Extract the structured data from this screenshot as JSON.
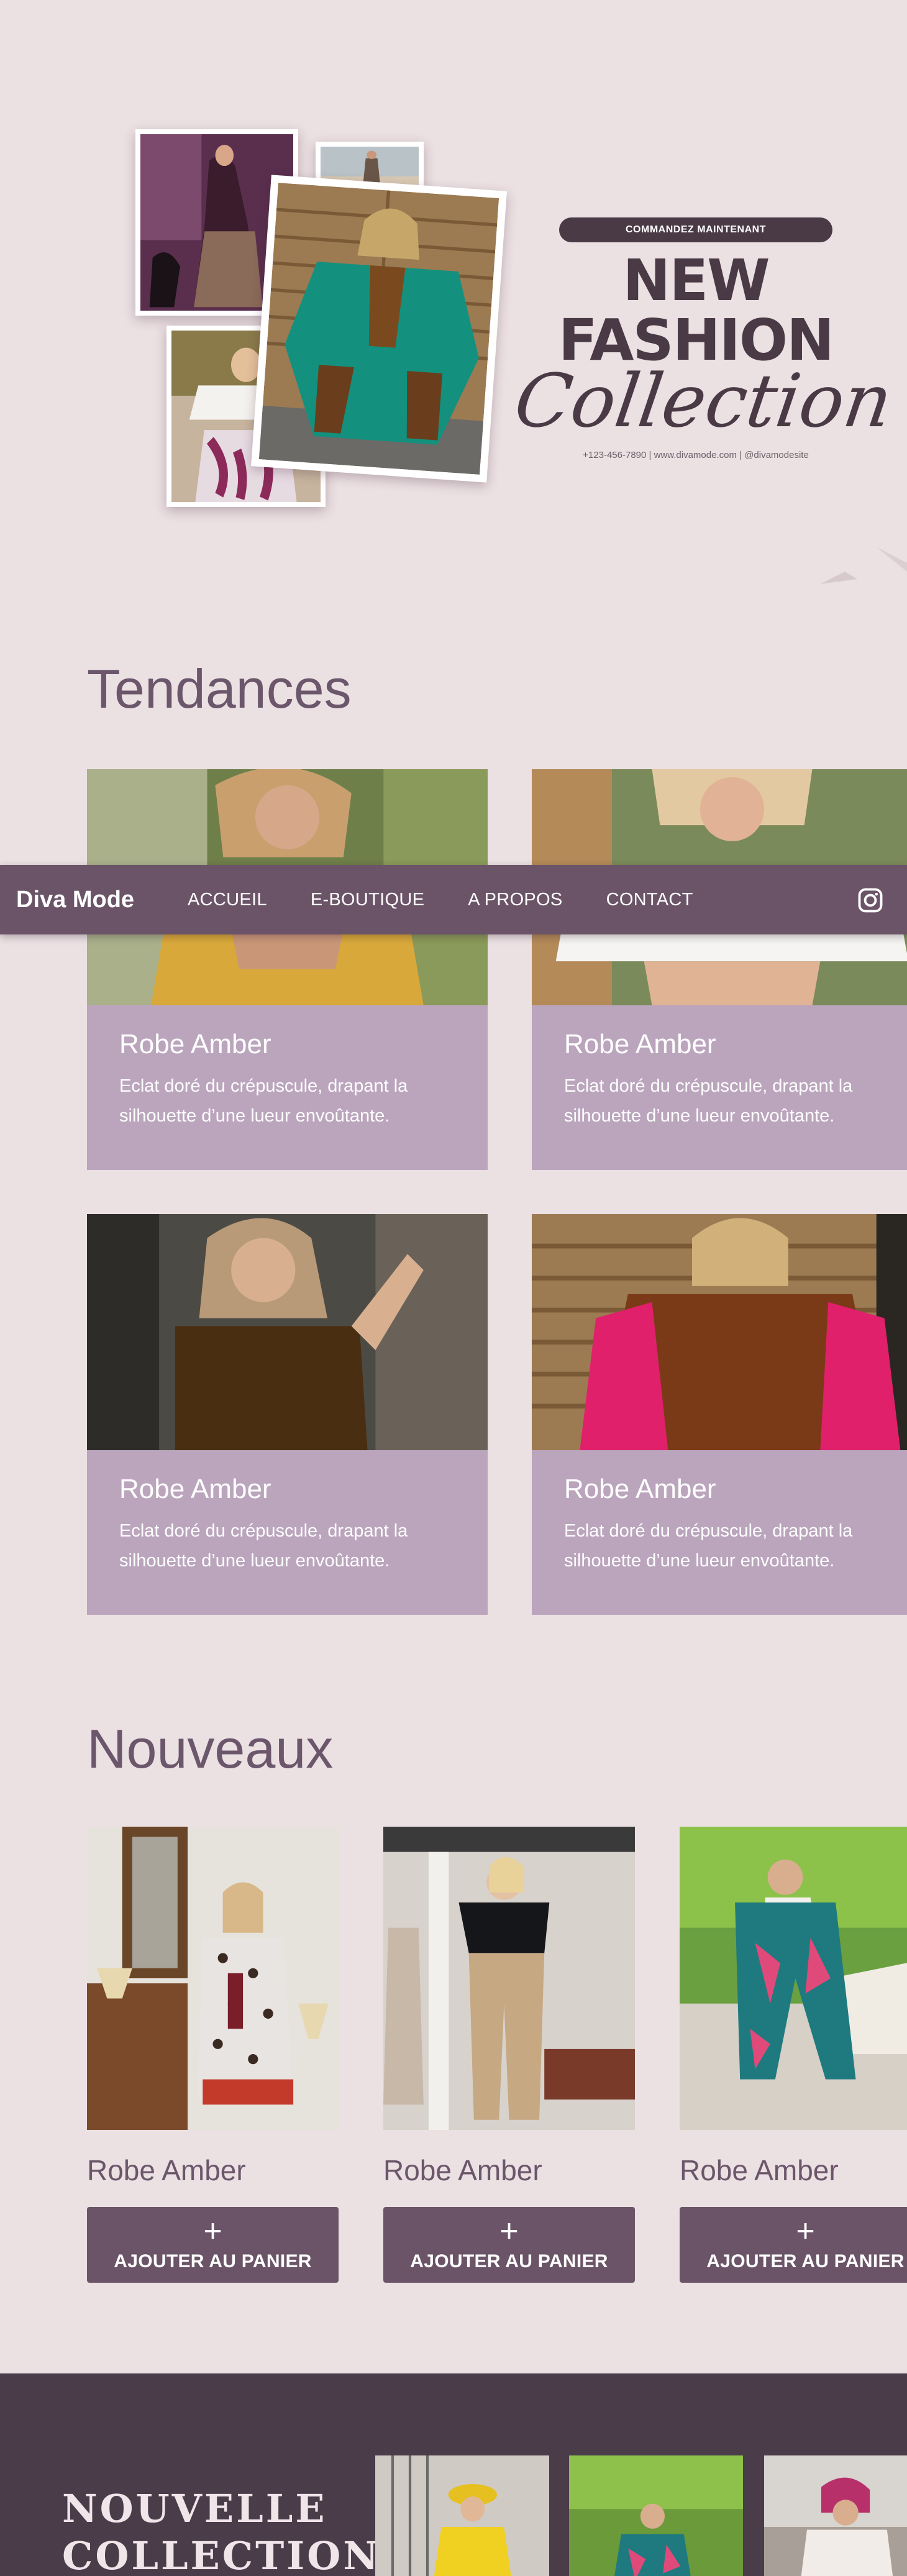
{
  "hero": {
    "cta": "COMMANDEZ MAINTENANT",
    "title_line1": "NEW FASHION",
    "title_line2": "Collection",
    "contact": "+123-456-7890 | www.divamode.com | @divamodesite",
    "photo_icons": [
      "photo-violet-dress",
      "photo-beach",
      "photo-teal-kaftan",
      "photo-white-top"
    ]
  },
  "nav": {
    "brand": "Diva Mode",
    "links": [
      "ACCUEIL",
      "E-BOUTIQUE",
      "A PROPOS",
      "CONTACT"
    ],
    "social_icon": "instagram-icon"
  },
  "tendances": {
    "title": "Tendances",
    "cards": [
      {
        "name": "Robe Amber",
        "desc_line1": "Eclat doré du crépuscule, drapant la",
        "desc_line2": "silhouette d’une lueur envoûtante."
      },
      {
        "name": "Robe Amber",
        "desc_line1": "Eclat doré du crépuscule, drapant la",
        "desc_line2": "silhouette d’une lueur envoûtante."
      },
      {
        "name": "Robe Amber",
        "desc_line1": "Eclat doré du crépuscule, drapant la",
        "desc_line2": "silhouette d’une lueur envoûtante."
      },
      {
        "name": "Robe Amber",
        "desc_line1": "Eclat doré du crépuscule, drapant la",
        "desc_line2": "silhouette d’une lueur envoûtante."
      }
    ]
  },
  "nouveaux": {
    "title": "Nouveaux",
    "items": [
      {
        "name": "Robe Amber",
        "button_icon": "+",
        "button": "AJOUTER AU PANIER"
      },
      {
        "name": "Robe Amber",
        "button_icon": "+",
        "button": "AJOUTER AU PANIER"
      },
      {
        "name": "Robe Amber",
        "button_icon": "+",
        "button": "AJOUTER AU PANIER"
      }
    ]
  },
  "footer_band": {
    "title_line1": "NOUVELLE",
    "title_line2": "COLLECTION"
  },
  "colors": {
    "page_bg": "#ebe0e2",
    "nav_bg": "#6b5467",
    "card_body": "#bba5bd",
    "dark_band": "#4a3c48",
    "heading": "#6b566b"
  }
}
